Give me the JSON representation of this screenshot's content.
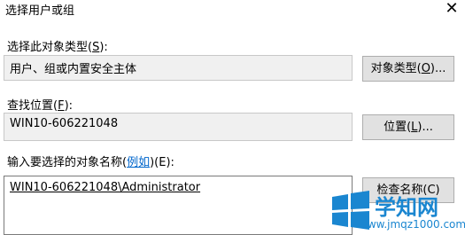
{
  "window": {
    "title": "选择用户或组",
    "close_glyph": "✕"
  },
  "object_type": {
    "label_prefix": "选择此对象类型(",
    "label_key": "S",
    "label_suffix": "):",
    "value": "用户、组或内置安全主体",
    "button_prefix": "对象类型(",
    "button_key": "O",
    "button_suffix": ")..."
  },
  "location": {
    "label_prefix": "查找位置(",
    "label_key": "F",
    "label_suffix": "):",
    "value": "WIN10-606221048",
    "button_prefix": "位置(",
    "button_key": "L",
    "button_suffix": ")..."
  },
  "names": {
    "label_prefix": "输入要选择的对象名称(",
    "label_link": "例如",
    "label_suffix": ")(E):",
    "value": "WIN10-606221048\\Administrator",
    "button_label": "检查名称(C)"
  },
  "watermark": {
    "text": "学知网",
    "url": "www.jmqz1000.com",
    "color": "#1a86d0"
  }
}
